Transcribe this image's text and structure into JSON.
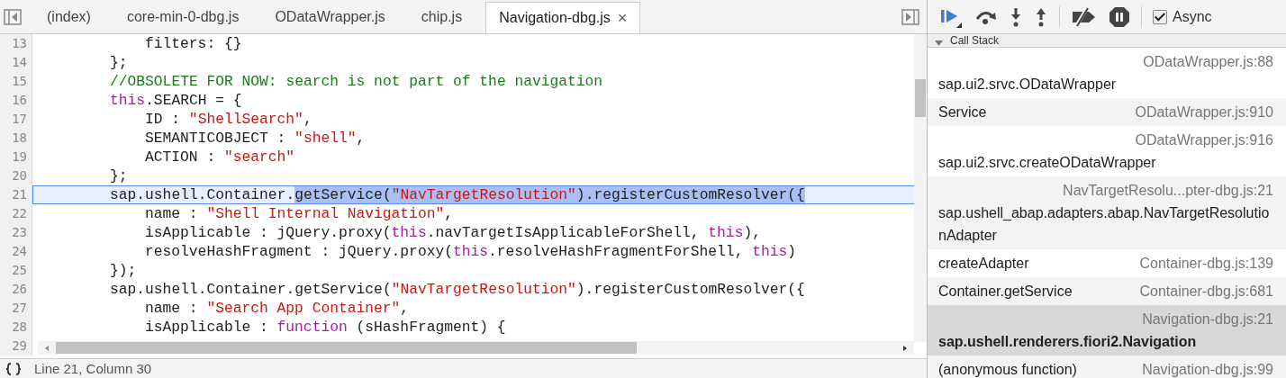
{
  "editor": {
    "tabs": [
      {
        "label": "(index)",
        "selected": false
      },
      {
        "label": "core-min-0-dbg.js",
        "selected": false
      },
      {
        "label": "ODataWrapper.js",
        "selected": false
      },
      {
        "label": "chip.js",
        "selected": false
      },
      {
        "label": "Navigation-dbg.js",
        "selected": true,
        "close": "×"
      }
    ],
    "lines": [
      {
        "number": "13",
        "current": false,
        "tokens": [
          {
            "kind": "plain",
            "text": "filters: {}",
            "selected": false
          }
        ]
      },
      {
        "number": "14",
        "current": false,
        "tokens": [
          {
            "kind": "plain",
            "text": "};",
            "selected": false
          }
        ]
      },
      {
        "number": "15",
        "current": false,
        "tokens": [
          {
            "kind": "comment",
            "text": "//OBSOLETE FOR NOW: search is not part of the navigation",
            "selected": false
          }
        ]
      },
      {
        "number": "16",
        "current": false,
        "tokens": [
          {
            "kind": "keyword",
            "text": "this",
            "selected": false
          },
          {
            "kind": "plain",
            "text": ".SEARCH = {",
            "selected": false
          }
        ]
      },
      {
        "number": "17",
        "current": false,
        "tokens": [
          {
            "kind": "plain",
            "text": "ID : ",
            "selected": false
          },
          {
            "kind": "string",
            "text": "\"ShellSearch\"",
            "selected": false
          },
          {
            "kind": "plain",
            "text": ",",
            "selected": false
          }
        ]
      },
      {
        "number": "18",
        "current": false,
        "tokens": [
          {
            "kind": "plain",
            "text": "SEMANTICOBJECT : ",
            "selected": false
          },
          {
            "kind": "string",
            "text": "\"shell\"",
            "selected": false
          },
          {
            "kind": "plain",
            "text": ",",
            "selected": false
          }
        ]
      },
      {
        "number": "19",
        "current": false,
        "tokens": [
          {
            "kind": "plain",
            "text": "ACTION : ",
            "selected": false
          },
          {
            "kind": "string",
            "text": "\"search\"",
            "selected": false
          }
        ]
      },
      {
        "number": "20",
        "current": false,
        "tokens": [
          {
            "kind": "plain",
            "text": "};",
            "selected": false
          }
        ]
      },
      {
        "number": "21",
        "current": true,
        "tokens": [
          {
            "kind": "plain",
            "text": "sap.ushell.Container.",
            "selected": false
          },
          {
            "kind": "plain",
            "text": "getService(",
            "selected": true
          },
          {
            "kind": "string",
            "text": "\"NavTargetResolution\"",
            "selected": true
          },
          {
            "kind": "plain",
            "text": ").registerCustomResolver({",
            "selected": true
          }
        ]
      },
      {
        "number": "22",
        "current": false,
        "tokens": [
          {
            "kind": "plain",
            "text": "name : ",
            "selected": false
          },
          {
            "kind": "string",
            "text": "\"Shell Internal Navigation\"",
            "selected": false
          },
          {
            "kind": "plain",
            "text": ",",
            "selected": false
          }
        ]
      },
      {
        "number": "23",
        "current": false,
        "tokens": [
          {
            "kind": "plain",
            "text": "isApplicable : jQuery.proxy(",
            "selected": false
          },
          {
            "kind": "keyword",
            "text": "this",
            "selected": false
          },
          {
            "kind": "plain",
            "text": ".navTargetIsApplicableForShell, ",
            "selected": false
          },
          {
            "kind": "keyword",
            "text": "this",
            "selected": false
          },
          {
            "kind": "plain",
            "text": "),",
            "selected": false
          }
        ]
      },
      {
        "number": "24",
        "current": false,
        "tokens": [
          {
            "kind": "plain",
            "text": "resolveHashFragment : jQuery.proxy(",
            "selected": false
          },
          {
            "kind": "keyword",
            "text": "this",
            "selected": false
          },
          {
            "kind": "plain",
            "text": ".resolveHashFragmentForShell, ",
            "selected": false
          },
          {
            "kind": "keyword",
            "text": "this",
            "selected": false
          },
          {
            "kind": "plain",
            "text": ")",
            "selected": false
          }
        ]
      },
      {
        "number": "25",
        "current": false,
        "tokens": [
          {
            "kind": "plain",
            "text": "});",
            "selected": false
          }
        ]
      },
      {
        "number": "26",
        "current": false,
        "tokens": [
          {
            "kind": "plain",
            "text": "sap.ushell.Container.getService(",
            "selected": false
          },
          {
            "kind": "string",
            "text": "\"NavTargetResolution\"",
            "selected": false
          },
          {
            "kind": "plain",
            "text": ").registerCustomResolver({",
            "selected": false
          }
        ]
      },
      {
        "number": "27",
        "current": false,
        "tokens": [
          {
            "kind": "plain",
            "text": "name : ",
            "selected": false
          },
          {
            "kind": "string",
            "text": "\"Search App Container\"",
            "selected": false
          },
          {
            "kind": "plain",
            "text": ",",
            "selected": false
          }
        ]
      },
      {
        "number": "28",
        "current": false,
        "tokens": [
          {
            "kind": "plain",
            "text": "isApplicable : ",
            "selected": false
          },
          {
            "kind": "keyword",
            "text": "function",
            "selected": false
          },
          {
            "kind": "plain",
            "text": " (sHashFragment) {",
            "selected": false
          }
        ]
      },
      {
        "number": "29",
        "current": false
      }
    ],
    "status_bar": {
      "position": "Line 21, Column 30"
    }
  },
  "debugger": {
    "async": {
      "label": "Async",
      "checked": true
    },
    "call_stack": {
      "title": "Call Stack",
      "expanded": true,
      "frames": [
        {
          "function": "sap.ui2.srvc.ODataWrapper",
          "location": "ODataWrapper.js:88",
          "selected": false
        },
        {
          "function": "Service",
          "location": "ODataWrapper.js:910",
          "selected": false
        },
        {
          "function": "sap.ui2.srvc.createODataWrapper",
          "location": "ODataWrapper.js:916",
          "selected": false
        },
        {
          "function": "sap.ushell_abap.adapters.abap.NavTargetResolutionAdapter",
          "location": "NavTargetResolu...pter-dbg.js:21",
          "selected": false
        },
        {
          "function": "createAdapter",
          "location": "Container-dbg.js:139",
          "selected": false
        },
        {
          "function": "Container.getService",
          "location": "Container-dbg.js:681",
          "selected": false
        },
        {
          "function": "sap.ushell.renderers.fiori2.Navigation",
          "location": "Navigation-dbg.js:21",
          "selected": true
        },
        {
          "function": "(anonymous function)",
          "location": "Navigation-dbg.js:99",
          "selected": false
        }
      ]
    }
  }
}
